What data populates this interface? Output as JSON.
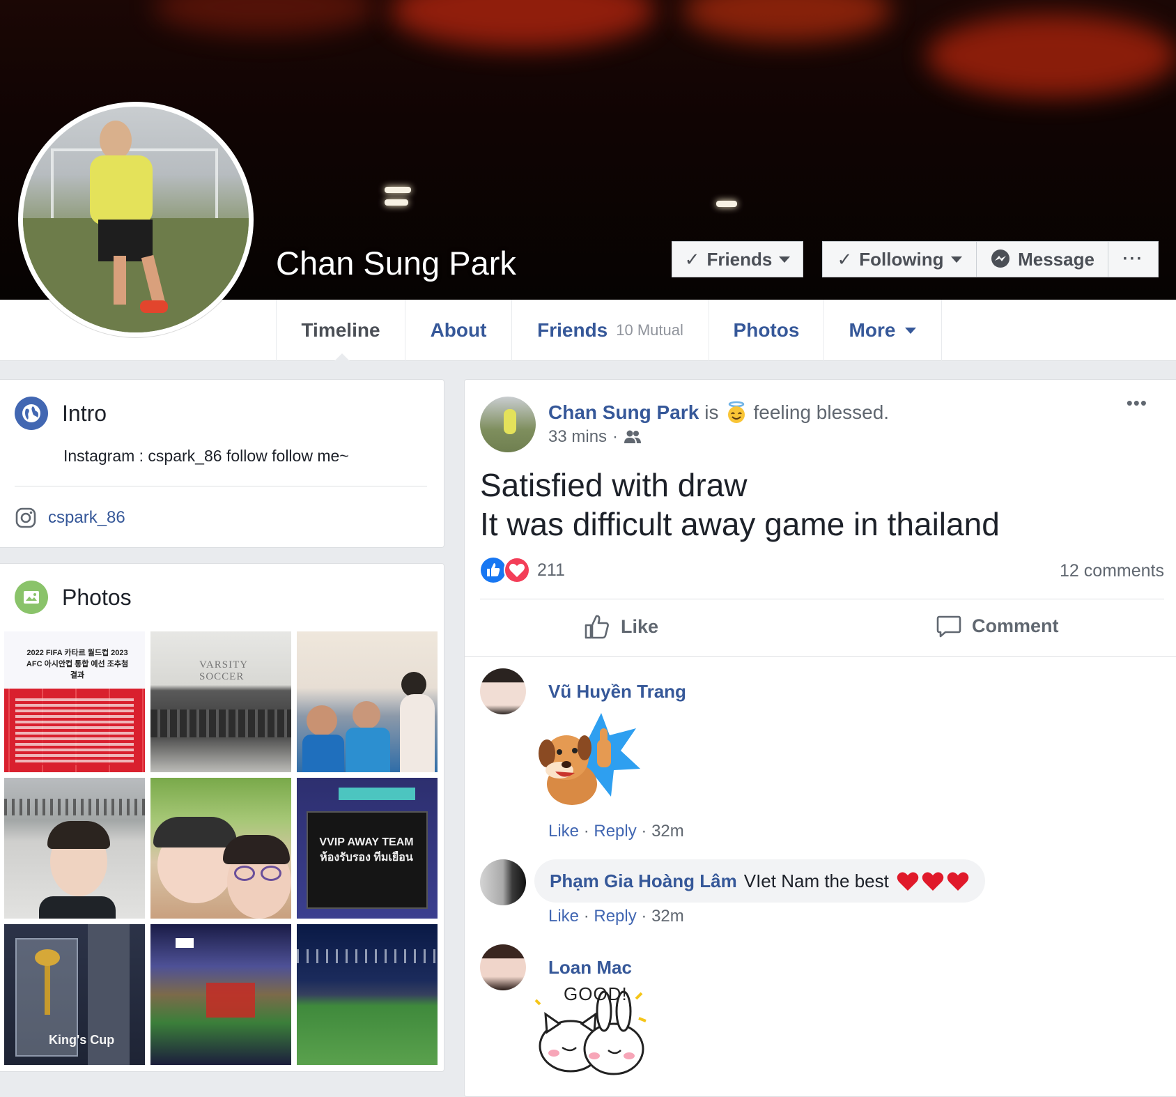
{
  "profile": {
    "name": "Chan Sung Park",
    "buttons": {
      "friends": "Friends",
      "following": "Following",
      "message": "Message",
      "more": "···"
    }
  },
  "tabs": [
    {
      "label": "Timeline"
    },
    {
      "label": "About"
    },
    {
      "label": "Friends",
      "sub": "10 Mutual"
    },
    {
      "label": "Photos"
    },
    {
      "label": "More"
    }
  ],
  "intro": {
    "title": "Intro",
    "bio": "Instagram : cspark_86 follow follow me~",
    "instagram": "cspark_86"
  },
  "photos": {
    "title": "Photos",
    "tiles": [
      {
        "caption": "2022 FIFA 카타르 월드컵 2023 AFC 아시안컵 통합 예선 조추첨 결과"
      },
      {
        "caption": "VARSITY SOCCER"
      },
      {
        "caption": ""
      },
      {
        "caption": ""
      },
      {
        "caption": ""
      },
      {
        "caption": "VVIP AWAY TEAM ห้องรับรอง ทีมเยือน"
      },
      {
        "caption": "King's Cup"
      },
      {
        "caption": ""
      },
      {
        "caption": ""
      }
    ]
  },
  "post": {
    "author": "Chan Sung Park",
    "is": "is",
    "feeling": "feeling blessed.",
    "time": "33 mins",
    "dot": "·",
    "text_line1": "Satisfied with draw",
    "text_line2": "It was difficult away game in thailand",
    "reaction_count": "211",
    "comment_count": "12 comments",
    "like_label": "Like",
    "comment_label": "Comment"
  },
  "comments": [
    {
      "author": "Vũ Huyền Trang",
      "text": "",
      "like": "Like",
      "reply": "Reply",
      "time": "32m",
      "sticker": "dog-thumbs-up"
    },
    {
      "author": "Phạm Gia Hoàng Lâm",
      "text": "VIet Nam the best",
      "like": "Like",
      "reply": "Reply",
      "time": "32m"
    },
    {
      "author": "Loan Mac",
      "text": "",
      "sticker_text": "GOOD!",
      "sticker": "cat-bunny-good"
    }
  ],
  "colors": {
    "link": "#365899",
    "like_blue": "#1877f2",
    "love_red": "#f33e58",
    "intro_globe": "#4267b2",
    "photos_green": "#8ac36a"
  }
}
